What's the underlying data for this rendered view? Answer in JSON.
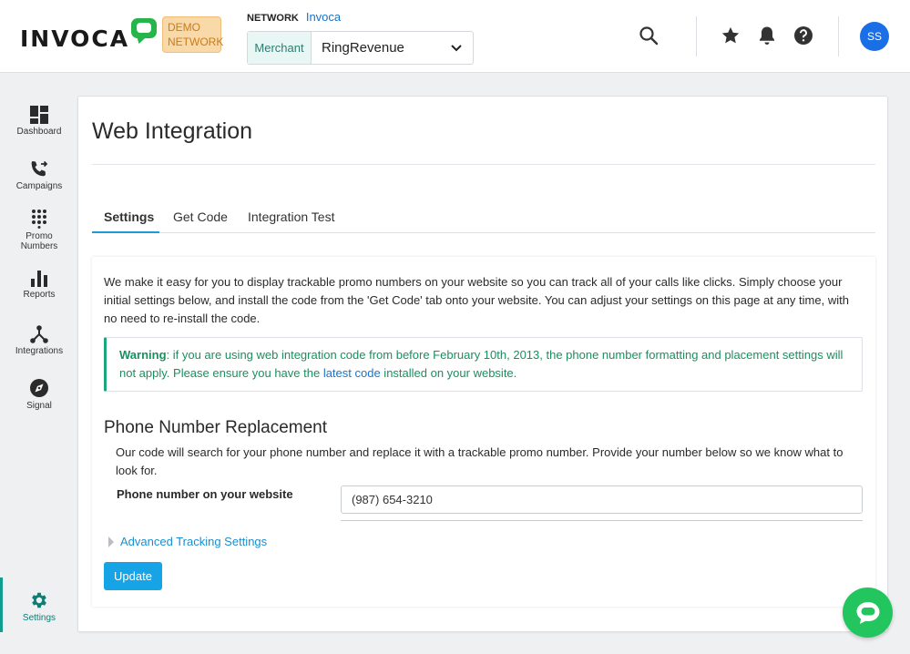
{
  "header": {
    "logo_text": "INVOCA",
    "demo_badge": "DEMO NETWORK",
    "network_label": "NETWORK",
    "network_name": "Invoca",
    "merchant_label": "Merchant",
    "merchant_value": "RingRevenue",
    "avatar_initials": "SS",
    "icons": [
      "search-icon",
      "star-icon",
      "bell-icon",
      "help-icon"
    ]
  },
  "sidebar": {
    "items": [
      {
        "label": "Dashboard",
        "icon": "dashboard-icon"
      },
      {
        "label": "Campaigns",
        "icon": "phone-forward-icon"
      },
      {
        "label": "Promo Numbers",
        "icon": "dialpad-icon"
      },
      {
        "label": "Reports",
        "icon": "bar-chart-icon"
      },
      {
        "label": "Integrations",
        "icon": "network-icon"
      },
      {
        "label": "Signal",
        "icon": "compass-icon"
      },
      {
        "label": "Settings",
        "icon": "gear-icon",
        "active": true
      }
    ]
  },
  "main": {
    "title": "Web Integration",
    "tabs": [
      {
        "label": "Settings",
        "active": true
      },
      {
        "label": "Get Code"
      },
      {
        "label": "Integration Test"
      }
    ],
    "intro": "We make it easy for you to display trackable promo numbers on your website so you can track all of your calls like clicks. Simply choose your initial settings below, and install the code from the 'Get Code' tab onto your website. You can adjust your settings on this page at any time, with no need to re-install the code.",
    "warning": {
      "label": "Warning",
      "text_before": ": if you are using web integration code from before February 10th, 2013, the phone number formatting and placement settings will not apply. Please ensure you have the ",
      "link": "latest code",
      "text_after": " installed on your website."
    },
    "section_title": "Phone Number Replacement",
    "section_desc": "Our code will search for your phone number and replace it with a trackable promo number. Provide your number below so we know what to look for.",
    "phone_label": "Phone number on your website",
    "phone_value": "(987) 654-3210",
    "advanced_label": "Advanced Tracking Settings",
    "update_label": "Update"
  },
  "colors": {
    "accent": "#17a4e6",
    "brand_green": "#25b54b",
    "warning_green": "#1a8f5f",
    "active_nav": "#0e7d74"
  }
}
